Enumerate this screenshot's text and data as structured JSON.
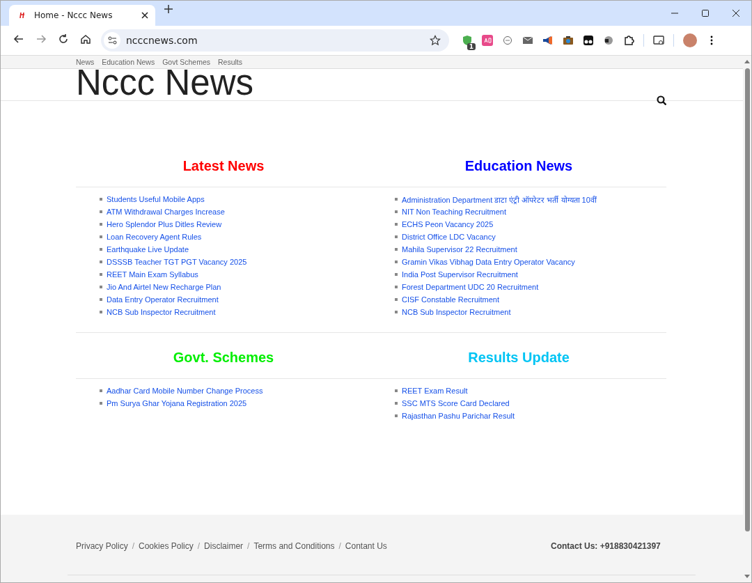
{
  "browser": {
    "tab": {
      "title": "Home - Nccc News",
      "selected": true
    },
    "url": "ncccnews.com",
    "extension_badge": "1"
  },
  "site": {
    "nav": [
      "News",
      "Education News",
      "Govt Schemes",
      "Results"
    ],
    "logo": "Nccc News",
    "sections": [
      {
        "title": "Latest News",
        "color": "#ff0000",
        "items": [
          "Students Useful Mobile Apps",
          "ATM Withdrawal Charges Increase",
          "Hero Splendor Plus Ditles Review",
          "Loan Recovery Agent Rules",
          "Earthquake Live Update",
          "DSSSB Teacher TGT PGT Vacancy 2025",
          "REET Main Exam Syllabus",
          "Jio And Airtel New Recharge Plan",
          "Data Entry Operator Recruitment",
          "NCB Sub Inspector Recruitment"
        ]
      },
      {
        "title": "Education News",
        "color": "#0000ff",
        "items": [
          "Administration Department डाटा एंट्री ऑपरेटर भर्ती योग्यता 10वीं",
          "NIT Non Teaching Recruitment",
          "ECHS Peon Vacancy 2025",
          "District Office LDC Vacancy",
          "Mahila Supervisor 22 Recruitment",
          "Gramin Vikas Vibhag Data Entry Operator Vacancy",
          "India Post Supervisor Recruitment",
          "Forest Department UDC 20 Recruitment",
          "CISF Constable Recruitment",
          "NCB Sub Inspector Recruitment"
        ]
      },
      {
        "title": "Govt. Schemes",
        "color": "#00ee00",
        "items": [
          "Aadhar Card Mobile Number Change Process",
          "Pm Surya Ghar Yojana Registration 2025"
        ]
      },
      {
        "title": "Results Update",
        "color": "#00c4f4",
        "items": [
          "REET Exam Result",
          "SSC MTS Score Card Declared",
          "Rajasthan Pashu Parichar Result"
        ]
      }
    ],
    "footer": {
      "separator": "/",
      "links": [
        "Privacy Policy",
        "Cookies Policy",
        "Disclaimer",
        "Terms and Conditions",
        "Contant Us"
      ],
      "contact": "Contact Us: +918830421397"
    }
  }
}
